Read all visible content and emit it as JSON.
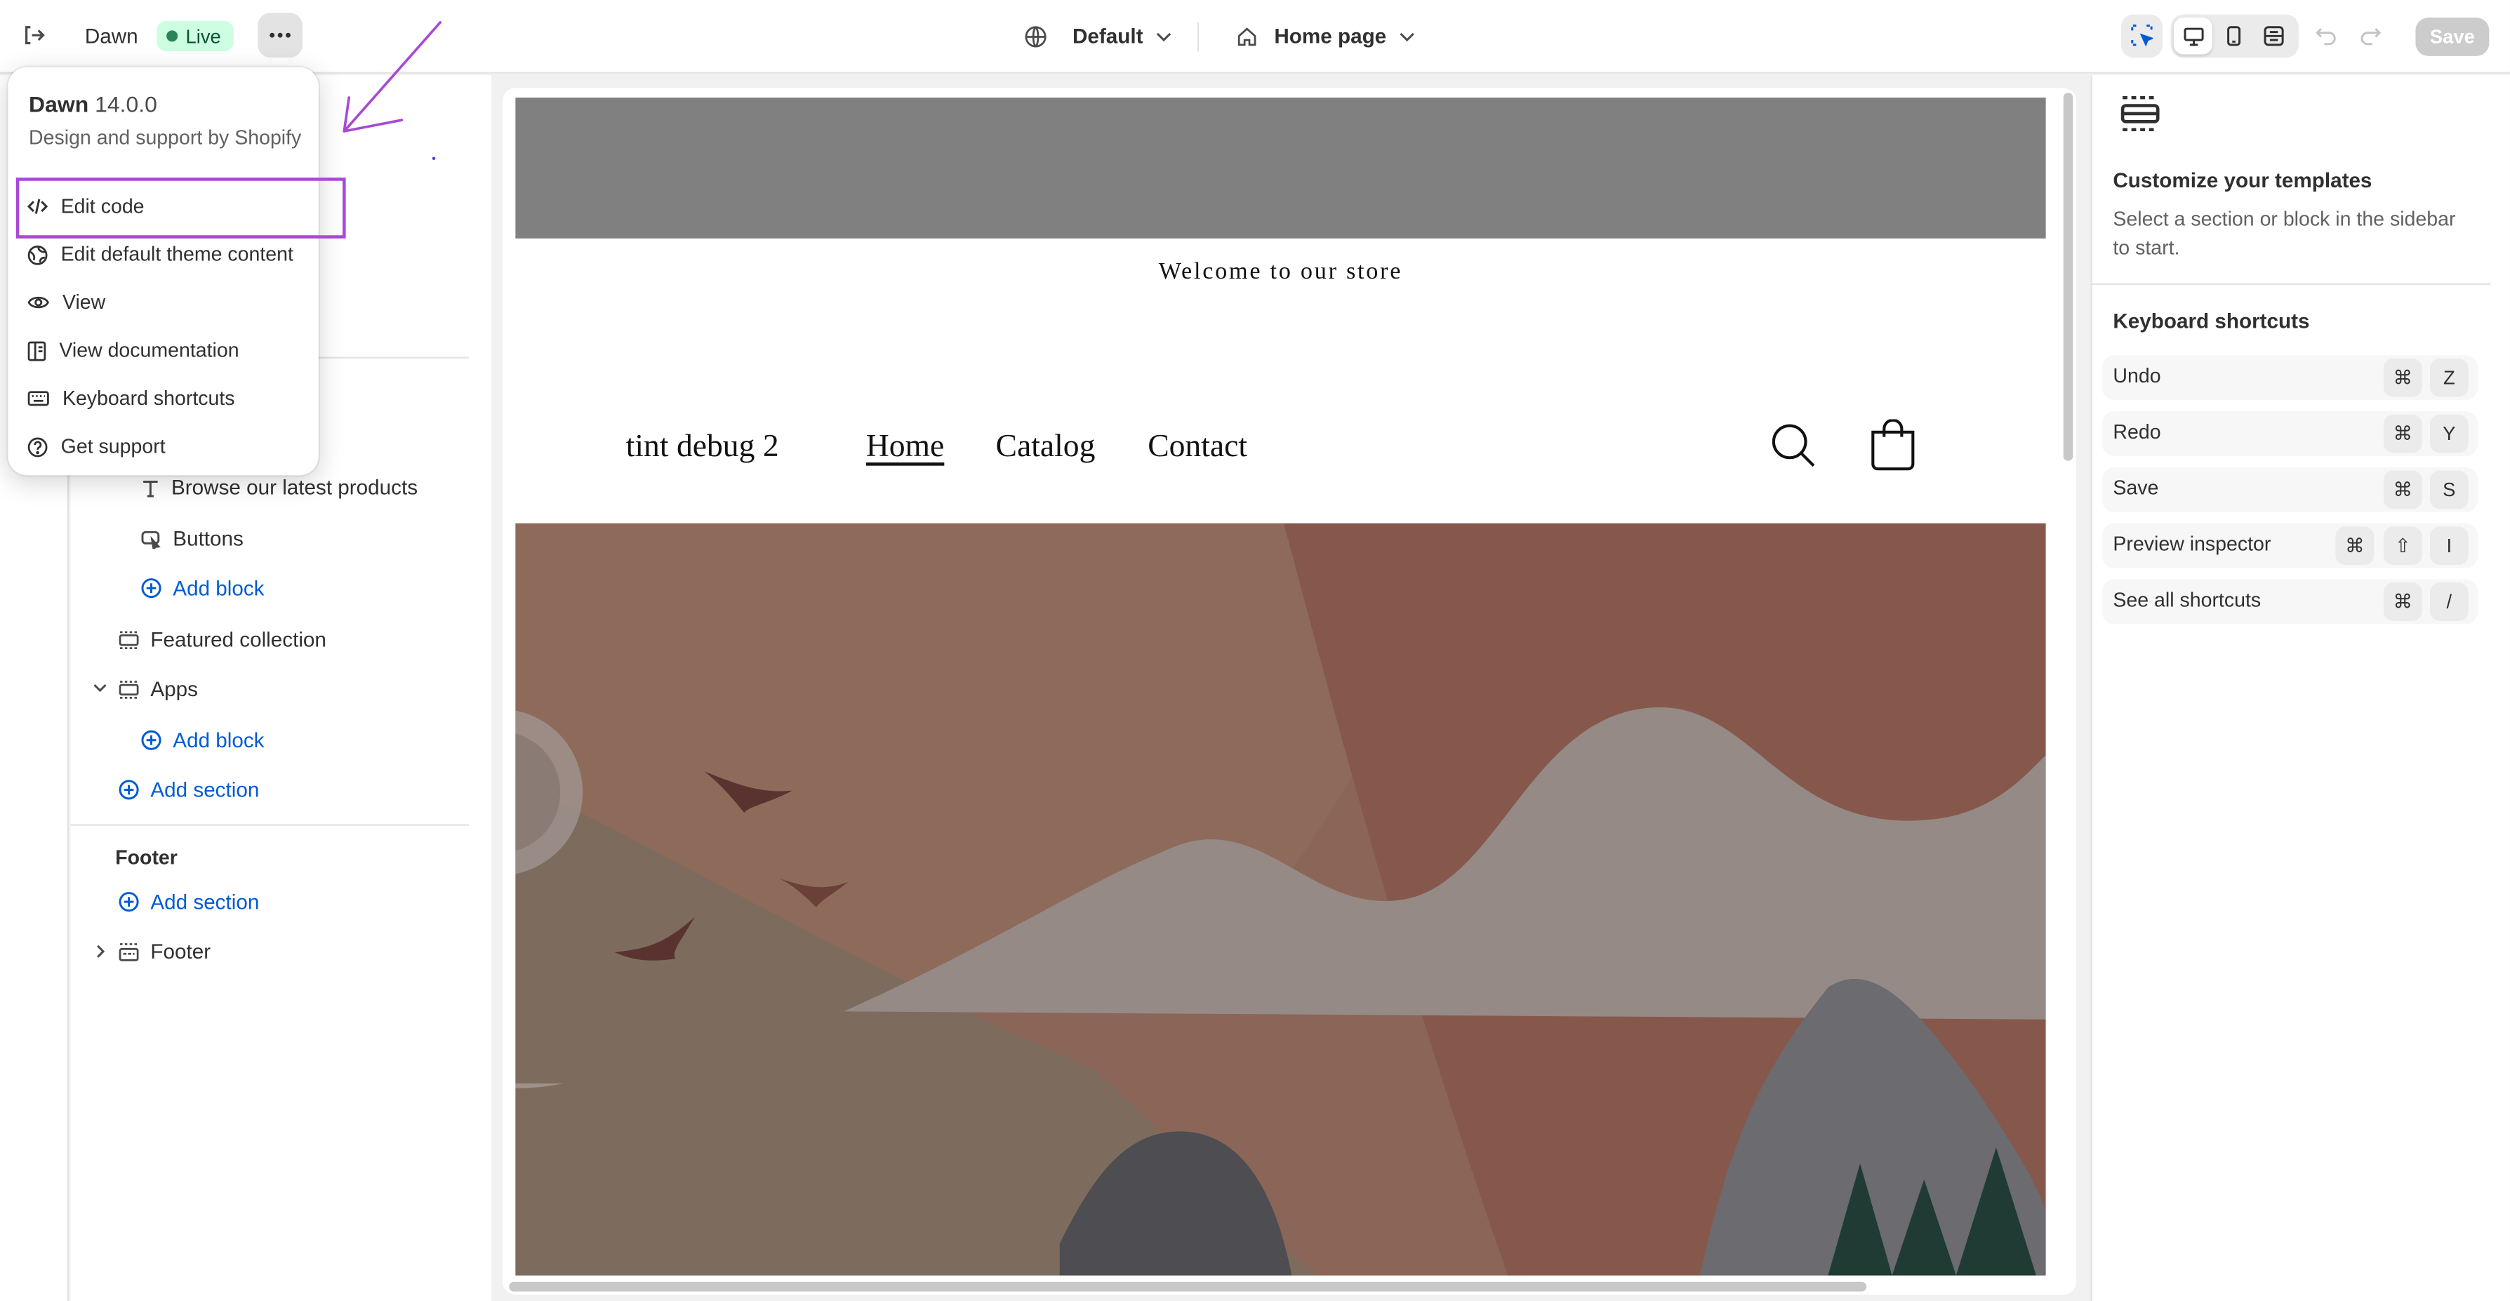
{
  "topbar": {
    "theme_name": "Dawn",
    "live_badge": "Live",
    "locale_label": "Default",
    "template_label": "Home page",
    "save_label": "Save"
  },
  "menu": {
    "theme_name": "Dawn",
    "theme_version": "14.0.0",
    "support_text": "Design and support by Shopify",
    "items": [
      {
        "label": "Edit code",
        "icon": "code-icon"
      },
      {
        "label": "Edit default theme content",
        "icon": "globe-icon"
      },
      {
        "label": "View",
        "icon": "eye-icon"
      },
      {
        "label": "View documentation",
        "icon": "book-icon"
      },
      {
        "label": "Keyboard shortcuts",
        "icon": "keyboard-icon"
      },
      {
        "label": "Get support",
        "icon": "question-icon"
      }
    ]
  },
  "sidebar": {
    "items": [
      {
        "label": "Browse our latest products",
        "icon": "text-icon"
      },
      {
        "label": "Buttons",
        "icon": "button-icon"
      },
      {
        "label": "Add block",
        "icon": "plus-circle-icon"
      },
      {
        "label": "Featured collection",
        "icon": "section-icon"
      },
      {
        "label": "Apps",
        "icon": "section-icon"
      },
      {
        "label": "Add block",
        "icon": "plus-circle-icon"
      },
      {
        "label": "Add section",
        "icon": "plus-circle-icon"
      }
    ],
    "footer_heading": "Footer",
    "footer_add_section": "Add section",
    "footer_item": "Footer"
  },
  "preview": {
    "announcement": "Welcome to our store",
    "store_name": "tint debug 2",
    "nav": [
      "Home",
      "Catalog",
      "Contact"
    ]
  },
  "right_panel": {
    "title": "Customize your templates",
    "description": "Select a section or block in the sidebar to start.",
    "shortcuts_title": "Keyboard shortcuts",
    "shortcuts": [
      {
        "label": "Undo",
        "keys": [
          "⌘",
          "Z"
        ]
      },
      {
        "label": "Redo",
        "keys": [
          "⌘",
          "Y"
        ]
      },
      {
        "label": "Save",
        "keys": [
          "⌘",
          "S"
        ]
      },
      {
        "label": "Preview inspector",
        "keys": [
          "⌘",
          "⇧",
          "I"
        ]
      },
      {
        "label": "See all shortcuts",
        "keys": [
          "⌘",
          "/"
        ]
      }
    ]
  },
  "colors": {
    "annotation": "#a849d6",
    "link_blue": "#005bd3",
    "live_green": "#29845a"
  }
}
